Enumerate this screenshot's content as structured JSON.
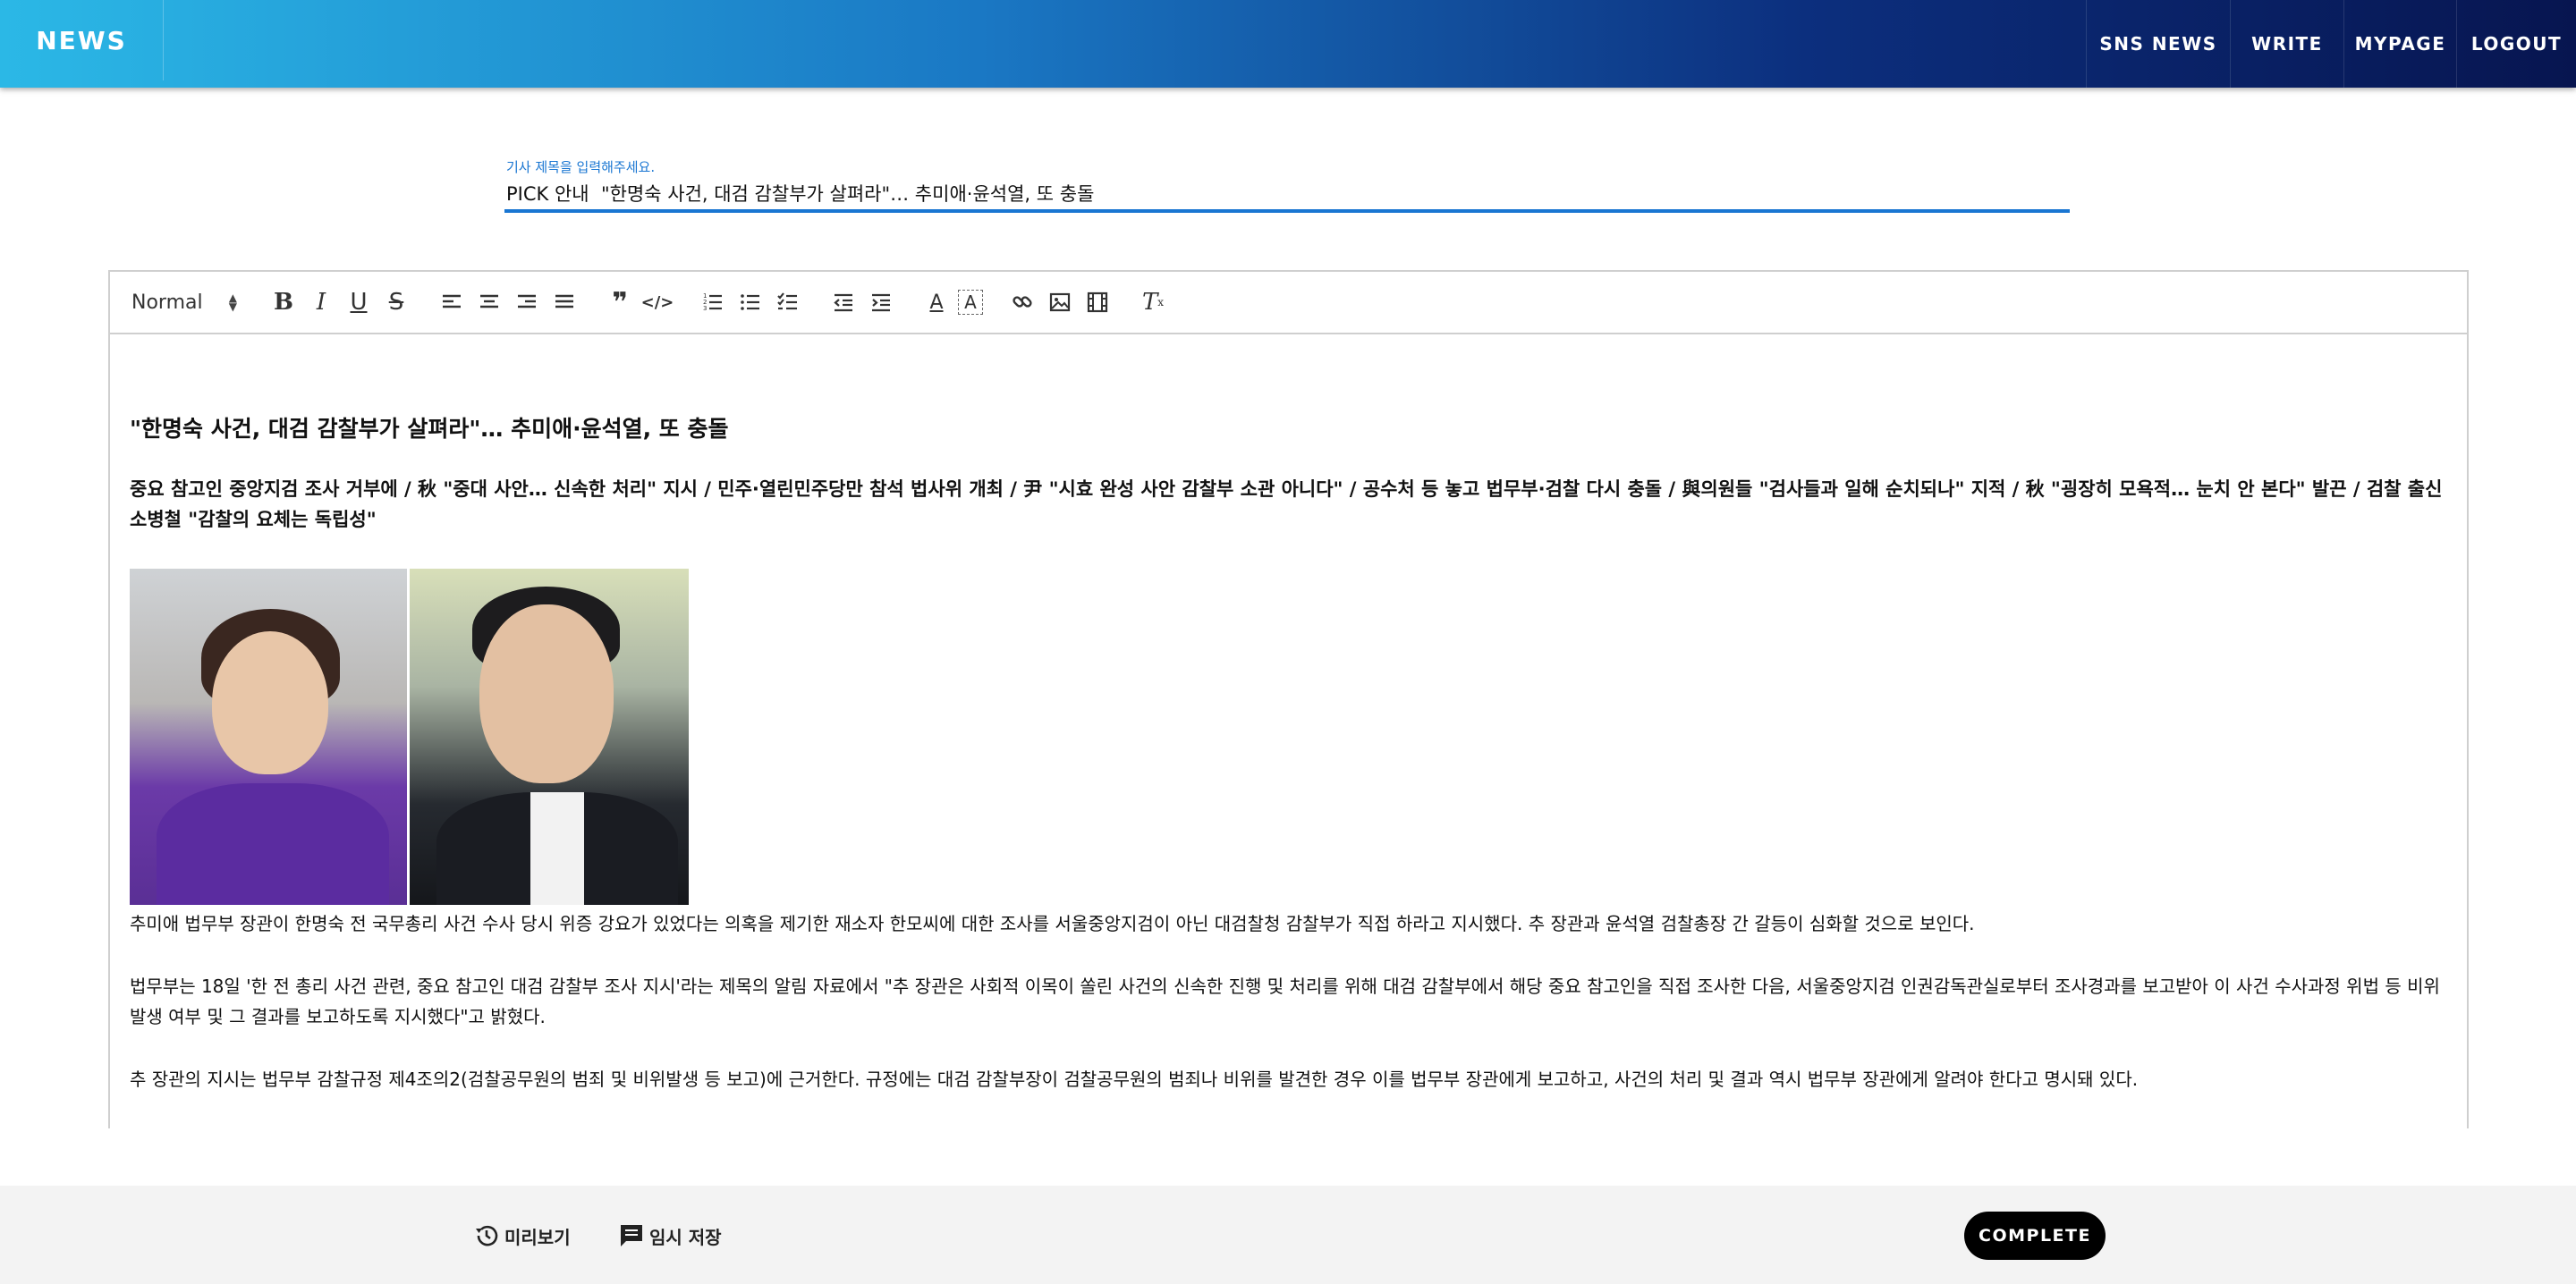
{
  "header": {
    "brand": "NEWS",
    "nav": [
      "SNS NEWS",
      "WRITE",
      "MYPAGE",
      "LOGOUT"
    ]
  },
  "title_field": {
    "hint": "기사 제목을 입력해주세요.",
    "value": "PICK 안내  \"한명숙 사건, 대검 감찰부가 살펴라\"… 추미애·윤석열, 또 충돌"
  },
  "toolbar": {
    "format_select": "Normal",
    "buttons": [
      "bold",
      "italic",
      "underline",
      "strike",
      "align-left",
      "align-center",
      "align-right",
      "align-justify",
      "blockquote",
      "code-block",
      "ordered-list",
      "bullet-list",
      "check-list",
      "outdent",
      "indent",
      "text-color",
      "background-color",
      "link",
      "image",
      "video",
      "clean"
    ]
  },
  "article": {
    "headline": "\"한명숙 사건, 대검 감찰부가 살펴라\"… 추미애·윤석열, 또 충돌",
    "subhead": "중요 참고인 중앙지검 조사 거부에 / 秋 \"중대 사안… 신속한 처리\" 지시 / 민주·열린민주당만 참석 법사위 개최 / 尹 \"시효 완성 사안 감찰부 소관 아니다\" / 공수처 등 놓고 법무부·검찰 다시 충돌 / 與의원들 \"검사들과 일해 순치되나\" 지적 / 秋 \"굉장히 모욕적… 눈치 안 본다\" 발끈 / 검찰 출신 소병철 \"감찰의 요체는 독립성\"",
    "photo_alt": "추미애 · 윤석열",
    "paragraphs": [
      "추미애 법무부 장관이 한명숙 전 국무총리 사건 수사 당시 위증 강요가 있었다는 의혹을 제기한 재소자 한모씨에 대한 조사를 서울중앙지검이 아닌 대검찰청 감찰부가 직접 하라고 지시했다. 추 장관과 윤석열 검찰총장 간 갈등이 심화할 것으로 보인다.",
      "법무부는 18일 '한 전 총리 사건 관련, 중요 참고인 대검 감찰부 조사 지시'라는 제목의 알림 자료에서 \"추 장관은 사회적 이목이 쏠린 사건의 신속한 진행 및 처리를 위해 대검 감찰부에서 해당 중요 참고인을 직접 조사한 다음, 서울중앙지검 인권감독관실로부터 조사경과를 보고받아 이 사건 수사과정 위법 등 비위발생 여부 및 그 결과를 보고하도록 지시했다\"고 밝혔다.",
      "추 장관의 지시는 법무부 감찰규정 제4조의2(검찰공무원의 범죄 및 비위발생 등 보고)에 근거한다. 규정에는 대검 감찰부장이 검찰공무원의 범죄나 비위를 발견한 경우 이를 법무부 장관에게 보고하고, 사건의 처리 및 결과 역시 법무부 장관에게 알려야 한다고 명시돼 있다."
    ]
  },
  "footer": {
    "preview": "미리보기",
    "temp_save": "임시 저장",
    "complete": "COMPLETE"
  }
}
